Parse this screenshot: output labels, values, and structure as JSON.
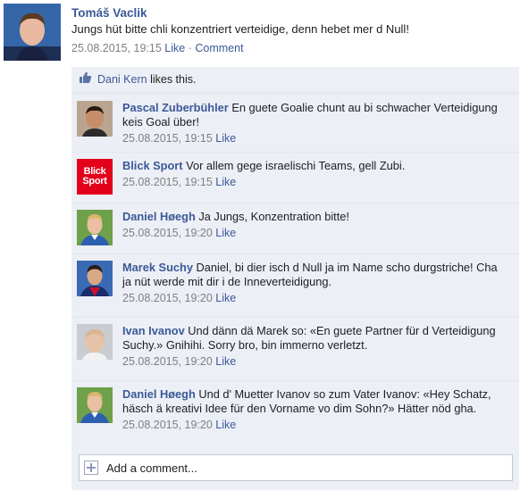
{
  "post": {
    "author": "Tomáš Vaclik",
    "text": "Jungs hüt bitte chli konzentriert verteidige, denn hebet mer d Null!",
    "timestamp": "25.08.2015, 19:15",
    "like_label": "Like",
    "separator": "·",
    "comment_label": "Comment"
  },
  "likes": {
    "liker": "Dani Kern",
    "suffix": "likes this."
  },
  "comments": [
    {
      "author": "Pascal Zuberbühler",
      "text": "En guete Goalie chunt au bi schwacher Verteidigung keis Goal über!",
      "timestamp": "25.08.2015, 19:15",
      "like_label": "Like",
      "avatar": "portrait-dark-hair"
    },
    {
      "author": "Blick Sport",
      "text": "Vor allem gege israelischi Teams, gell Zubi.",
      "timestamp": "25.08.2015, 19:15",
      "like_label": "Like",
      "avatar": "blick-logo",
      "logo_line1": "Blick",
      "logo_line2": "Sport"
    },
    {
      "author": "Daniel Høegh",
      "text": "Ja Jungs, Konzentration bitte!",
      "timestamp": "25.08.2015, 19:20",
      "like_label": "Like",
      "avatar": "portrait-blond-kit"
    },
    {
      "author": "Marek Suchy",
      "text": "Daniel, bi dier isch d Null ja im Name scho durgstriche! Cha ja nüt werde mit dir i de Inneverteidigung.",
      "timestamp": "25.08.2015, 19:20",
      "like_label": "Like",
      "avatar": "portrait-dark-kit"
    },
    {
      "author": "Ivan Ivanov",
      "text": "Und dänn dä Marek so: «En guete Partner für d Verteidigung Suchy.» Gnihihi. Sorry bro, bin immerno verletzt.",
      "timestamp": "25.08.2015, 19:20",
      "like_label": "Like",
      "avatar": "portrait-bald"
    },
    {
      "author": "Daniel Høegh",
      "text": "Und d' Muetter Ivanov so zum Vater Ivanov: «Hey Schatz, häsch ä kreativi Idee für den Vorname vo dim Sohn?» Hätter nöd gha.",
      "timestamp": "25.08.2015, 19:20",
      "like_label": "Like",
      "avatar": "portrait-blond-kit"
    }
  ],
  "add_comment": {
    "placeholder": "Add a comment..."
  },
  "colors": {
    "link": "#3b5998",
    "ufi_background": "#eceff5",
    "meta_gray": "#7f7f7f",
    "blick_red": "#e3001b"
  }
}
